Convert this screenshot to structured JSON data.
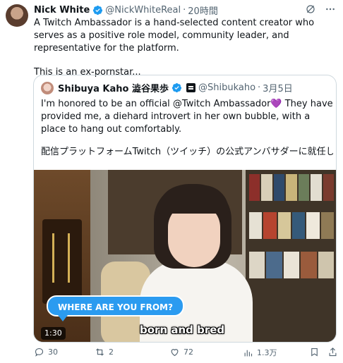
{
  "tweet": {
    "author_name": "Nick White",
    "handle": "@NickWhiteReal",
    "separator": "·",
    "time": "20時間",
    "text_1": "A Twitch Ambassador is a hand-selected content creator who serves as a positive role model, community leader, and representative for the platform.",
    "text_2": "This is an ex-pornstar...",
    "icons": [
      "grok-icon",
      "more-icon"
    ]
  },
  "quote": {
    "author_name": "Shibuya Kaho 澁谷果歩",
    "handle": "@Shibukaho",
    "separator": "·",
    "date": "3月5日",
    "text_1": "I'm honored to be an official @Twitch Ambassador💜 They have provided me, a diehard introvert in her own bubble, with a place to hang out comfortably.",
    "text_2": "配信プラットフォームTwitch（ツイッチ）の公式アンバサダーに就任し...",
    "video": {
      "speech_bubble": "WHERE ARE YOU FROM?",
      "caption": "born and bred",
      "duration": "1:30"
    }
  },
  "actions": {
    "replies": "30",
    "reposts": "2",
    "likes": "72",
    "views": "1.3万"
  },
  "colors": {
    "verified": "#1d9bf0",
    "text": "#0f1419",
    "muted": "#536471",
    "border": "#cfd9de",
    "bubble": "#2b9bf0"
  }
}
